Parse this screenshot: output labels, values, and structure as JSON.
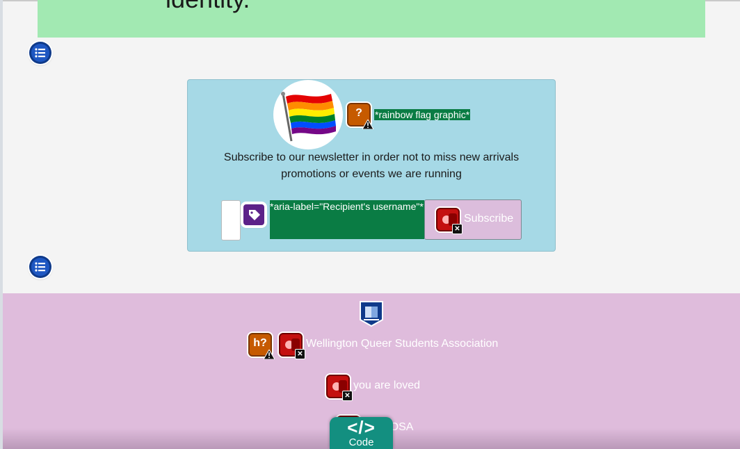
{
  "hero": {
    "heading": "identity."
  },
  "newsletter": {
    "image_alt_label": "*rainbow flag graphic*",
    "description_line1": "Subscribe to our newsletter in order not to miss new arrivals",
    "description_line2": "promotions or events we are running",
    "input_aria_label": "*aria-label=\"Recipient's username\"*",
    "subscribe_label": "Subscribe",
    "flag_badge_text": "?"
  },
  "footer": {
    "org_badge_text": "h?",
    "org_name": "Wellington Queer Students Association",
    "tagline": "you are loved",
    "third_item": "VOSA"
  },
  "code_tab": {
    "glyph": "</>",
    "label": "Code"
  },
  "colors": {
    "hero_bg": "#a2e9b2",
    "card_bg": "#a6d9e6",
    "footer_bg": "#dfbcdc",
    "label_green": "#0a7c44",
    "code_tab": "#138f80"
  }
}
